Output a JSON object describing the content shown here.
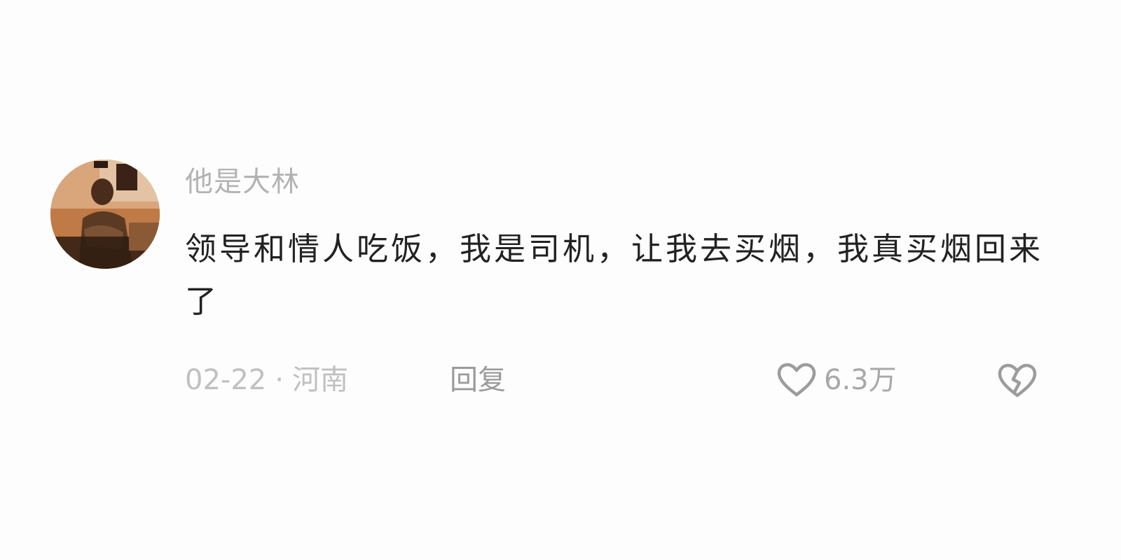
{
  "comment": {
    "username": "他是大林",
    "text": "领导和情人吃饭，我是司机，让我去买烟，我真买烟回来了",
    "date": "02-22",
    "separator": "·",
    "location": "河南",
    "reply_label": "回复",
    "like_count": "6.3万"
  },
  "icons": {
    "like": "heart-outline-icon",
    "dislike": "broken-heart-icon"
  },
  "colors": {
    "background": "#fdfdfd",
    "text": "#222222",
    "muted": "#b3b3b3"
  }
}
